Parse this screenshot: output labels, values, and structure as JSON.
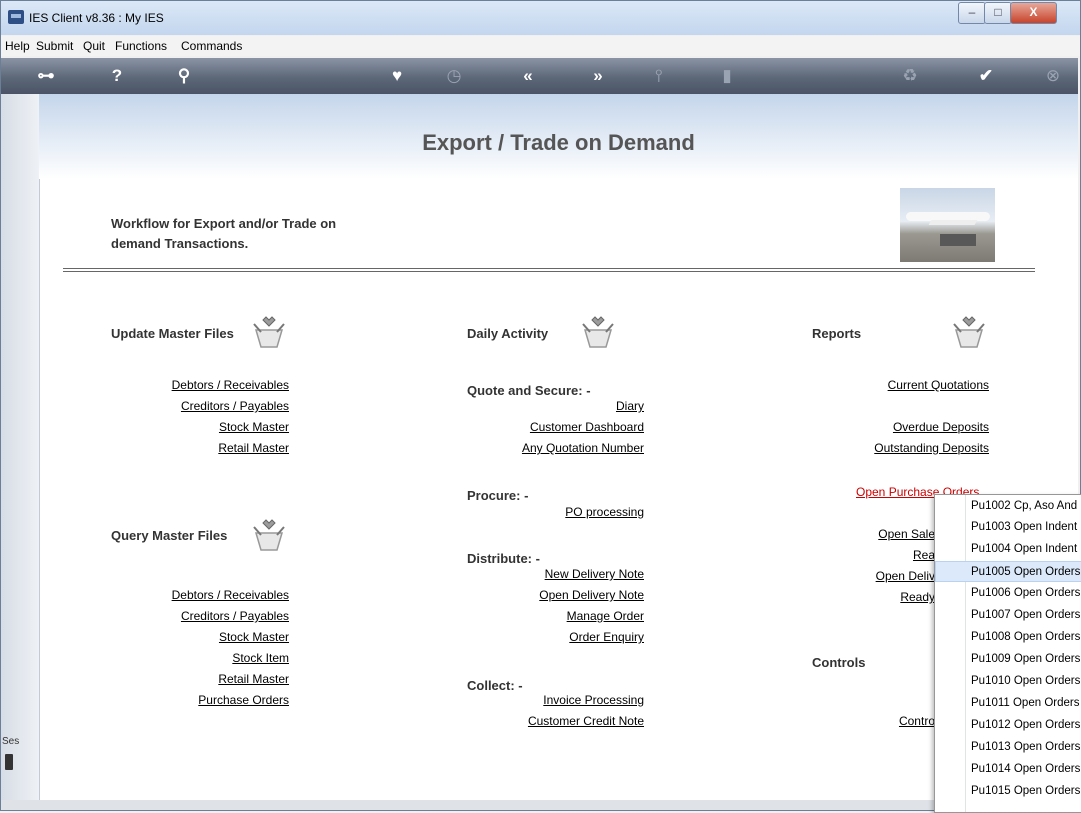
{
  "window": {
    "title": "IES Client v8.36 : My IES",
    "btn_min": "–",
    "btn_max": "□",
    "btn_close": "X"
  },
  "menu": [
    "Help",
    "Submit",
    "Quit",
    "Functions",
    "Commands"
  ],
  "toolbar_icons": [
    "key-icon",
    "help-icon",
    "search-icon",
    "heart-icon",
    "clock-icon",
    "back-icon",
    "forward-icon",
    "pin-icon",
    "screen-icon",
    "recycle-icon",
    "check-icon",
    "close-icon"
  ],
  "page": {
    "title": "Export / Trade on Demand",
    "subtitle": "Workflow for Export and/or Trade on demand Transactions."
  },
  "col1": {
    "update_header": "Update Master Files",
    "update_links": [
      "Debtors / Receivables",
      "Creditors / Payables",
      "Stock Master",
      "Retail Master"
    ],
    "query_header": "Query Master Files",
    "query_links": [
      "Debtors / Receivables",
      "Creditors / Payables",
      "Stock Master",
      "Stock Item",
      "Retail Master",
      "Purchase Orders"
    ]
  },
  "col2": {
    "header": "Daily Activity",
    "quote_header": "Quote and Secure: -",
    "quote_links": [
      "Diary",
      "Customer Dashboard",
      "Any Quotation Number"
    ],
    "procure_header": "Procure: -",
    "procure_links": [
      "PO processing"
    ],
    "distribute_header": "Distribute: -",
    "distribute_links": [
      "New Delivery Note",
      "Open Delivery Note",
      "Manage Order",
      "Order Enquiry"
    ],
    "collect_header": "Collect: -",
    "collect_links": [
      "Invoice Processing",
      "Customer Credit Note"
    ]
  },
  "col3": {
    "header": "Reports",
    "links": [
      "Current Quotations",
      "Overdue Deposits",
      "Outstanding Deposits"
    ],
    "active_link": "Open Purchase Orders",
    "partial_links": [
      "Open Sale",
      "Rea",
      "Open Deliv",
      "Ready"
    ],
    "controls_header": "Controls",
    "controls_partial": "Contro"
  },
  "session": {
    "label": "Ses"
  },
  "dropdown": {
    "items": [
      "Pu1002 Cp, Aso And",
      "Pu1003 Open Indent",
      "Pu1004 Open Indent",
      "Pu1005 Open Orders",
      "Pu1006 Open Orders",
      "Pu1007 Open Orders",
      "Pu1008 Open Orders",
      "Pu1009 Open Orders",
      "Pu1010 Open Orders",
      "Pu1011 Open Orders",
      "Pu1012 Open Orders",
      "Pu1013 Open Orders",
      "Pu1014 Open Orders",
      "Pu1015 Open Orders"
    ],
    "selected": "Pu1005 Open Orders"
  }
}
